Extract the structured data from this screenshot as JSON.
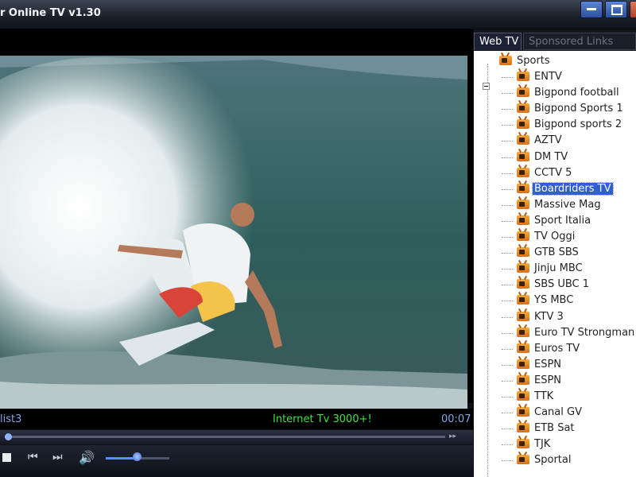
{
  "window": {
    "title": "r Online TV v1.30"
  },
  "player": {
    "playlist_label": "list3",
    "promo_text": "Internet Tv 3000+!",
    "time": "00:07",
    "seek_progress": 0.01,
    "volume_level": 0.45
  },
  "tabs": [
    {
      "label": "Web TV",
      "active": true
    },
    {
      "label": "Sponsored Links",
      "active": false
    }
  ],
  "tree": {
    "category": "Sports",
    "selected": "Boardriders TV",
    "channels": [
      "ENTV",
      "Bigpond football",
      "Bigpond Sports 1",
      "Bigpond sports 2",
      "AZTV",
      "DM TV",
      "CCTV 5",
      "Boardriders TV",
      "Massive Mag",
      "Sport Italia",
      "TV Oggi",
      "GTB SBS",
      "Jinju MBC",
      "SBS UBC 1",
      "YS MBC",
      "KTV 3",
      "Euro TV Strongman",
      "Euros TV",
      "ESPN",
      "ESPN",
      "TTK",
      "Canal GV",
      "ETB Sat",
      "TJK",
      "Sportal"
    ]
  },
  "icons": {
    "channel": "tv-icon",
    "folder": "tv-folder-icon"
  }
}
